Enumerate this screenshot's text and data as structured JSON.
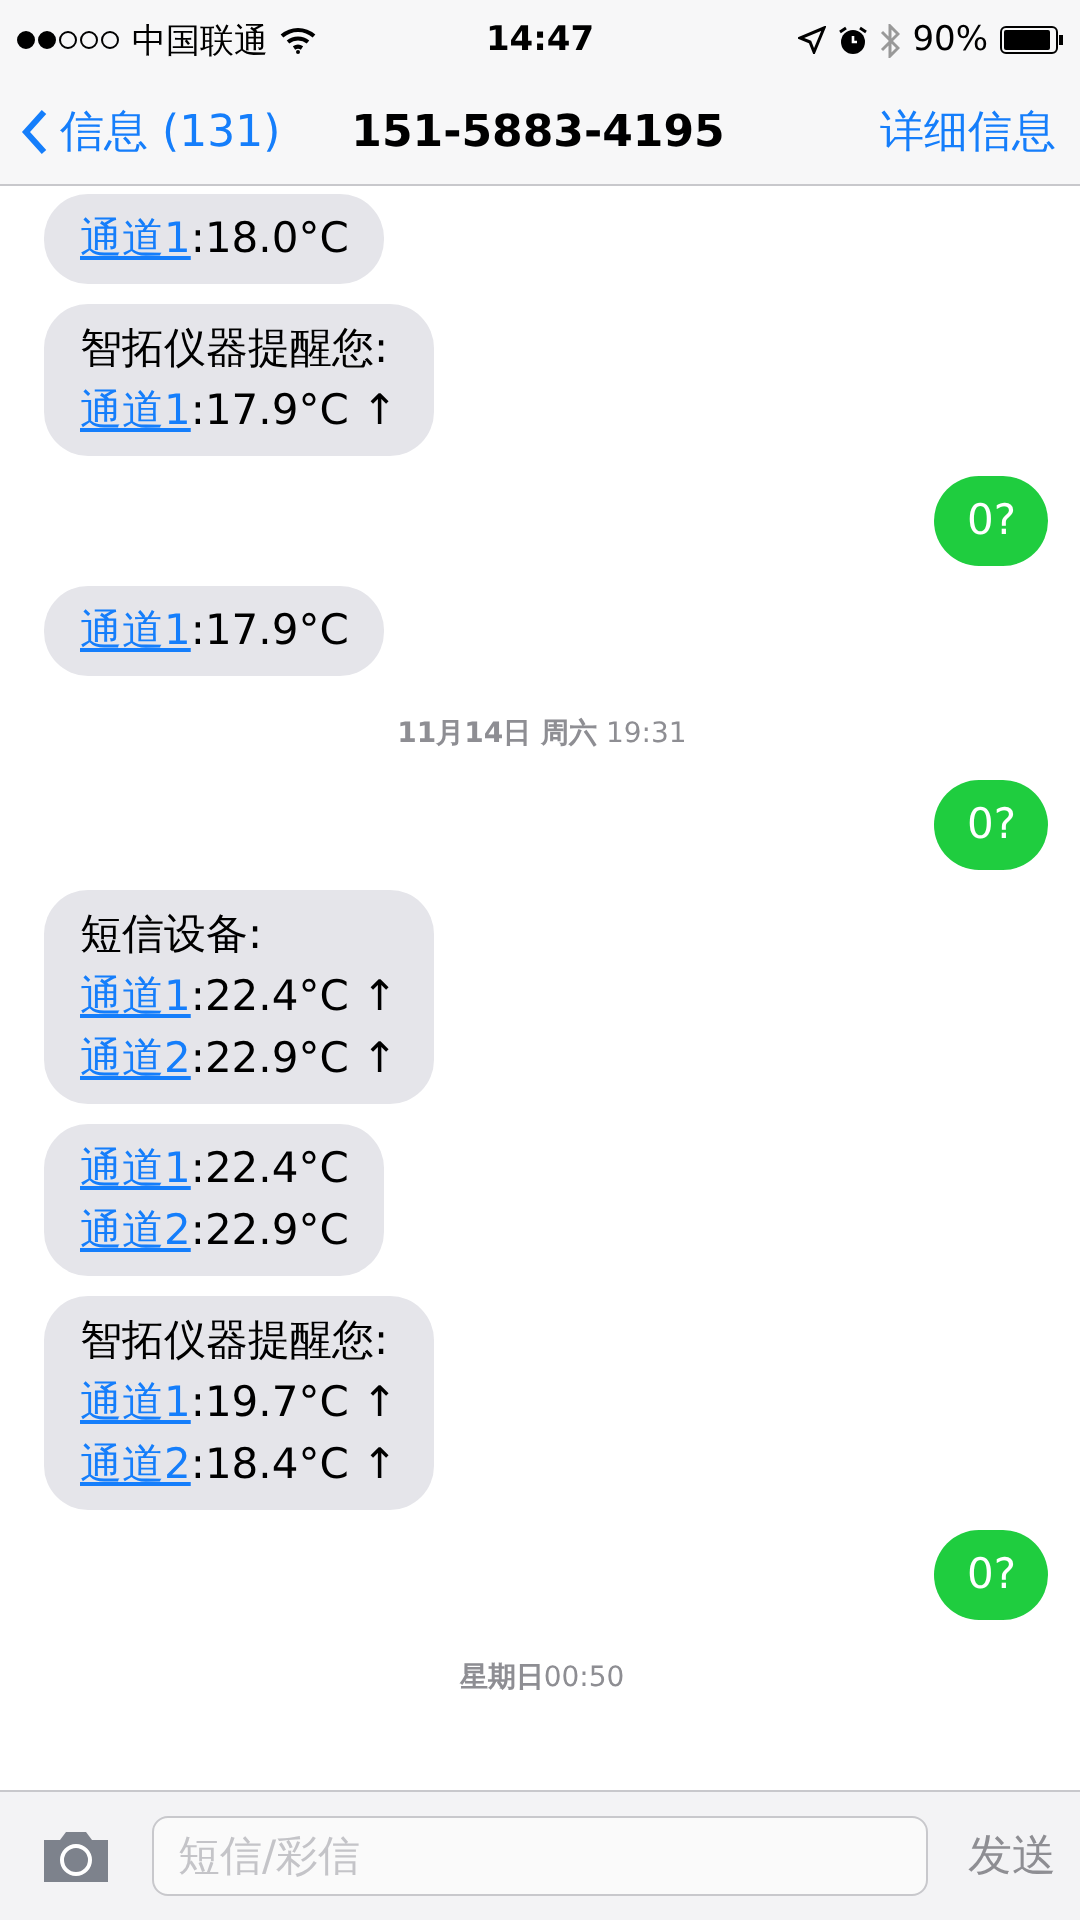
{
  "status_bar": {
    "carrier": "中国联通",
    "time": "14:47",
    "battery": "90%"
  },
  "nav": {
    "back": "信息 (131)",
    "title": "151-5883-4195",
    "action": "详细信息"
  },
  "messages": [
    {
      "kind": "incoming",
      "lines": [
        {
          "link": "通道1",
          "text": ":18.0°C"
        }
      ]
    },
    {
      "kind": "incoming",
      "lines": [
        {
          "text": "智拓仪器提醒您:"
        },
        {
          "link": "通道1",
          "text": ":17.9°C ↑"
        }
      ]
    },
    {
      "kind": "outgoing",
      "lines": [
        {
          "text": "0?"
        }
      ]
    },
    {
      "kind": "incoming",
      "lines": [
        {
          "link": "通道1",
          "text": ":17.9°C"
        }
      ]
    },
    {
      "kind": "timestamp",
      "text": "**11月14日 周六** 19:31"
    },
    {
      "kind": "outgoing",
      "lines": [
        {
          "text": "0?"
        }
      ]
    },
    {
      "kind": "incoming",
      "lines": [
        {
          "text": "短信设备:"
        },
        {
          "link": "通道1",
          "text": ":22.4°C ↑"
        },
        {
          "link": "通道2",
          "text": ":22.9°C ↑"
        }
      ]
    },
    {
      "kind": "incoming",
      "lines": [
        {
          "link": "通道1",
          "text": ":22.4°C"
        },
        {
          "link": "通道2",
          "text": ":22.9°C"
        }
      ]
    },
    {
      "kind": "incoming",
      "lines": [
        {
          "text": "智拓仪器提醒您:"
        },
        {
          "link": "通道1",
          "text": ":19.7°C ↑"
        },
        {
          "link": "通道2",
          "text": ":18.4°C ↑"
        }
      ]
    },
    {
      "kind": "outgoing",
      "lines": [
        {
          "text": "0?"
        }
      ]
    },
    {
      "kind": "timestamp",
      "text": "**星期日**00:50"
    }
  ],
  "composer": {
    "placeholder": "短信/彩信",
    "send": "发送"
  }
}
